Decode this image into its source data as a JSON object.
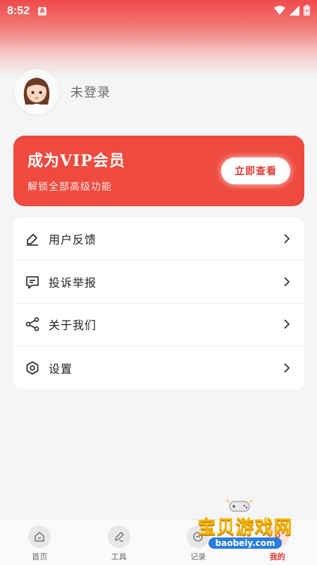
{
  "status_bar": {
    "time": "8:52",
    "badge": "A"
  },
  "profile": {
    "login_text": "未登录"
  },
  "vip": {
    "title": "成为VIP会员",
    "subtitle": "解锁全部高级功能",
    "button": "立即查看"
  },
  "menu": {
    "items": [
      {
        "label": "用户反馈",
        "icon": "feedback-icon"
      },
      {
        "label": "投诉举报",
        "icon": "report-icon"
      },
      {
        "label": "关于我们",
        "icon": "share-icon"
      },
      {
        "label": "设置",
        "icon": "settings-icon"
      }
    ]
  },
  "tabs": [
    {
      "label": "首页",
      "icon": "home-icon"
    },
    {
      "label": "工具",
      "icon": "pen-icon"
    },
    {
      "label": "记录",
      "icon": "record-icon"
    },
    {
      "label": "我的",
      "icon": "user-icon",
      "active": true
    }
  ],
  "watermark": {
    "title": "宝贝游戏网",
    "url": "baobeiy.com"
  },
  "colors": {
    "accent": "#ee4a3f",
    "background": "#f4f5f7"
  }
}
